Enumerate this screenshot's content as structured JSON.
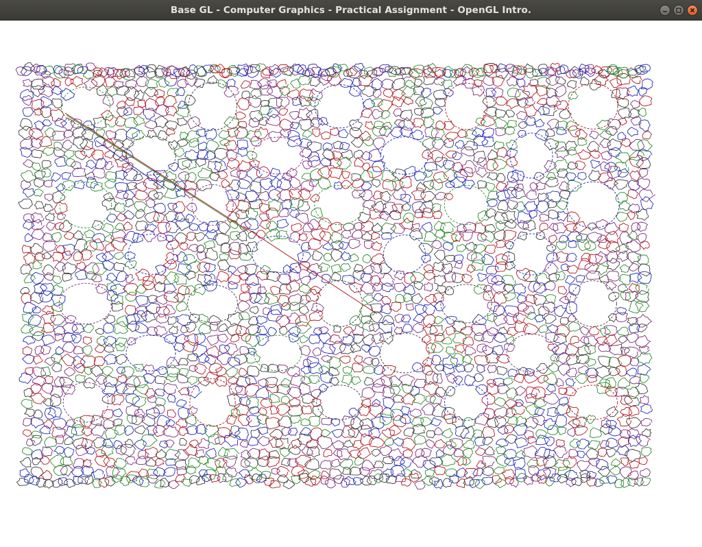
{
  "window": {
    "title": "Base GL - Computer Graphics - Practical Assignment - OpenGL Intro."
  },
  "controls": {
    "minimize_icon": "minimize-icon",
    "maximize_icon": "maximize-icon",
    "close_icon": "close-icon"
  },
  "render": {
    "background": "#ffffff",
    "line_colors": [
      "#b0161e",
      "#2a8a2a",
      "#1e28b4",
      "#7a2a7a",
      "#3a3a3a"
    ]
  }
}
